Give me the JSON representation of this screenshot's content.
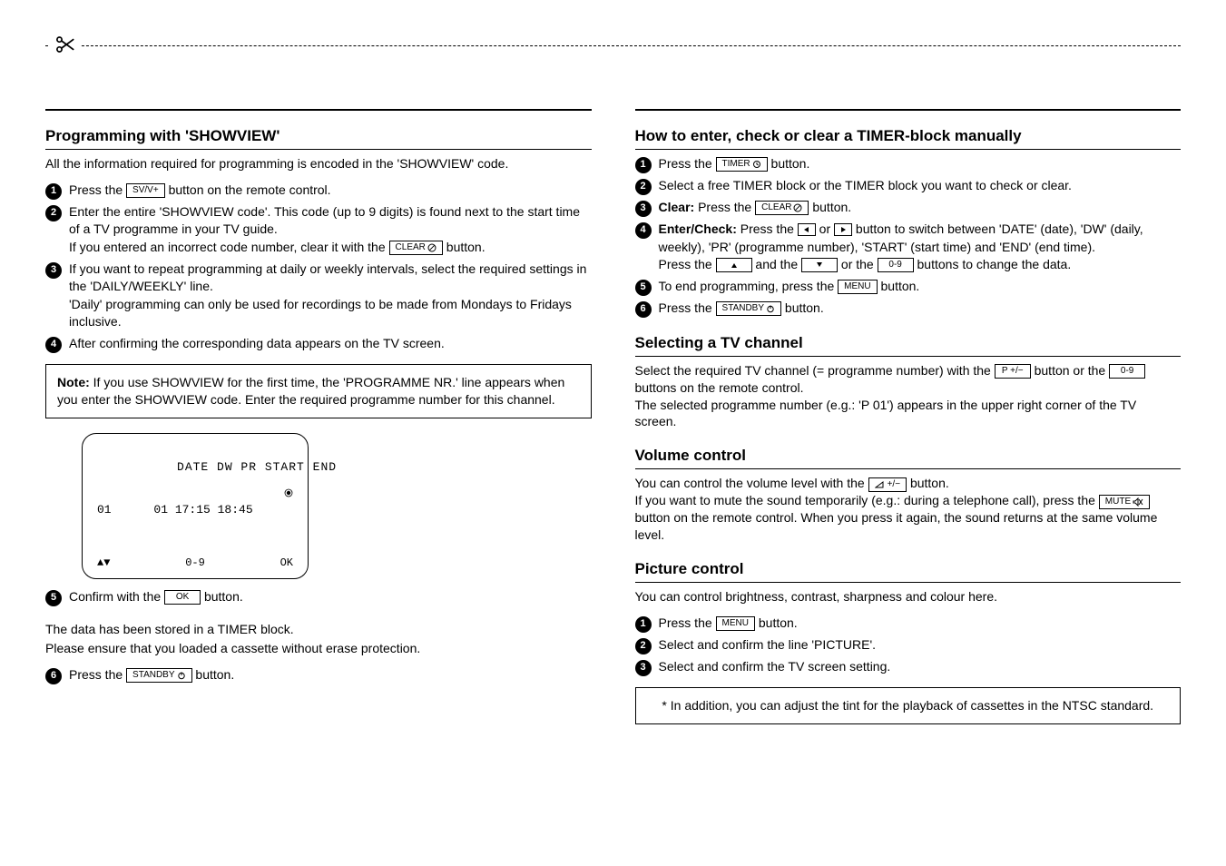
{
  "left": {
    "h_showview": "Programming with 'SHOWVIEW'",
    "intro": "All the information required for programming is encoded in the 'SHOWVIEW' code.",
    "s1a": "Press the ",
    "s1_btn": "SV/V+",
    "s1b": " button on the remote control.",
    "s2a": "Enter the entire 'SHOWVIEW code'. This code (up to 9 digits) is found next to the start time of a TV programme in your TV guide.",
    "s2b_a": "If you entered an incorrect code number, clear it with the ",
    "s2b_btn": "CLEAR",
    "s2b_b": " button.",
    "s3a": "If you want to repeat programming at daily or weekly intervals, select the required settings in the 'DAILY/WEEKLY' line.",
    "s3b": "'Daily' programming can only be used for recordings to be made from Mondays to Fridays inclusive.",
    "s4": "After confirming the corresponding data appears on the TV screen.",
    "note_strong": "Note:",
    "note": " If you use SHOWVIEW for the first time, the 'PROGRAMME NR.' line appears when you enter the SHOWVIEW code. Enter the required programme number for this channel.",
    "osd": {
      "header": "DATE DW PR START END",
      "row": "01      01 17:15 18:45",
      "ft_left": "▲▼",
      "ft_mid": "0-9",
      "ft_right": "OK"
    },
    "s5a": "Confirm with the ",
    "s5_btn": "OK",
    "s5b": " button.",
    "footer_a": "The data has been stored in a TIMER block.",
    "footer_b": "Please ensure that you loaded a cassette without erase protection.",
    "s6a": "Press the ",
    "s6_btn": "STANDBY",
    "s6b": " button."
  },
  "right": {
    "h_timer": "How to enter, check or clear a TIMER-block manually",
    "t1a": "Press the ",
    "t1_btn": "TIMER",
    "t1b": " button.",
    "t2": "Select a free TIMER block or the TIMER block you want to check or clear.",
    "t3_strong": "Clear:",
    "t3a": " Press the ",
    "t3_btn": "CLEAR",
    "t3b": " button.",
    "t4_strong": "Enter/Check:",
    "t4a": " Press the ",
    "t4mid": " or ",
    "t4b": " button to switch between 'DATE' (date), 'DW' (daily, weekly), 'PR' (programme number), 'START' (start time) and 'END' (end time).",
    "t4c_a": "Press the ",
    "t4c_and": " and the ",
    "t4c_or": " or the ",
    "t4c_btn09": "0-9",
    "t4c_b": " buttons to change the data.",
    "t5a": "To end programming, press the ",
    "t5_btn": "MENU",
    "t5b": " button.",
    "t6a": "Press the ",
    "t6_btn": "STANDBY",
    "t6b": " button.",
    "h_tv": "Selecting a TV channel",
    "tv_a": "Select the required TV channel (= programme number) with the ",
    "tv_btn_p": "P +/−",
    "tv_mid": " button or the ",
    "tv_btn_09": "0-9",
    "tv_b": " buttons on the remote control.",
    "tv_c": "The selected programme number (e.g.: 'P 01') appears in the upper right corner of the TV screen.",
    "h_vol": "Volume control",
    "vol_a": "You can control the volume level with the ",
    "vol_btn": "⊿ +/−",
    "vol_b": " button.",
    "vol_c_a": "If you want to mute the sound temporarily (e.g.: during a telephone call), press the ",
    "vol_mute": "MUTE",
    "vol_c_b": " button on the remote control. When you press it again, the sound returns at the same volume level.",
    "h_pic": "Picture control",
    "pic_a": "You can control brightness, contrast, sharpness and colour here.",
    "p1a": "Press the ",
    "p1_btn": "MENU",
    "p1b": " button.",
    "p2": "Select and confirm the line 'PICTURE'.",
    "p3": "Select and confirm the TV screen setting.",
    "pic_note": "* In addition, you can adjust the tint for the playback of cassettes in the NTSC standard."
  }
}
